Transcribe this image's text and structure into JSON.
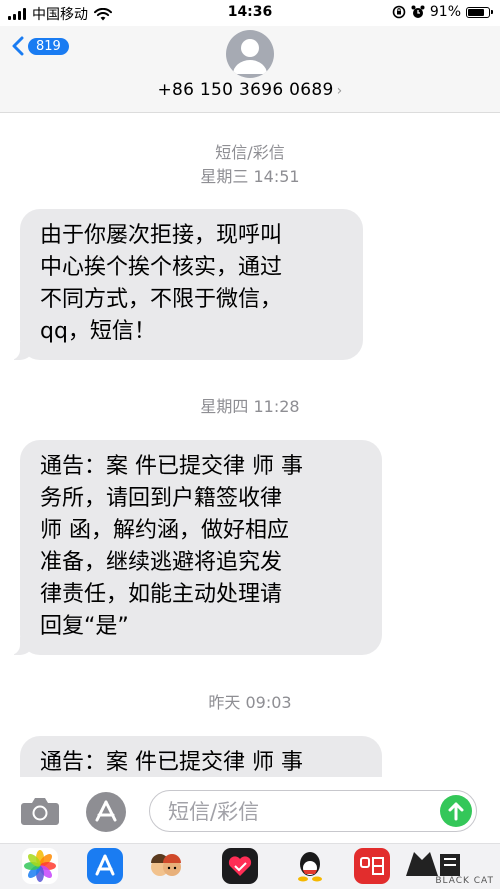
{
  "status_bar": {
    "carrier": "中国移动",
    "time": "14:36",
    "battery": "91%",
    "battery_level": 0.91
  },
  "header": {
    "back_count": "819",
    "contact": "+86 150 3696 0689",
    "contact_arrow": "›"
  },
  "thread": {
    "service_label": "短信/彩信",
    "items": [
      {
        "timestamp": "星期三 14:51",
        "text": "由于你屡次拒接，现呼叫\n中心挨个挨个核实，通过\n不同方式，不限于微信，\nqq，短信！"
      },
      {
        "timestamp": "星期四 11:28",
        "text": "通告：案 件已提交律 师 事\n务所，请回到户籍签收律\n师 函，解约涵，做好相应\n准备，继续逃避将追究发\n律责任，如能主动处理请\n回复“是”"
      },
      {
        "timestamp": "昨天 09:03",
        "text": "通告：案 件已提交律 师 事\n务所，请回到户籍签收律"
      }
    ]
  },
  "input_bar": {
    "placeholder": "短信/彩信"
  },
  "watermark": {
    "text": "BLACK CAT"
  },
  "colors": {
    "accent": "#1a7cf2",
    "bubble": "#e9e9eb",
    "send": "#34c759",
    "timestamp": "#8e8e93"
  },
  "icons": [
    "signal-icon",
    "wifi-icon",
    "lock-rotation-icon",
    "alarm-icon",
    "battery-icon",
    "back-chevron-icon",
    "contact-avatar-icon",
    "camera-icon",
    "app-store-icon",
    "send-arrow-icon",
    "photos-app-icon",
    "app-store-drawer-icon",
    "memoji-icon",
    "digital-touch-icon",
    "qq-icon",
    "changba-icon",
    "black-cat-logo"
  ]
}
